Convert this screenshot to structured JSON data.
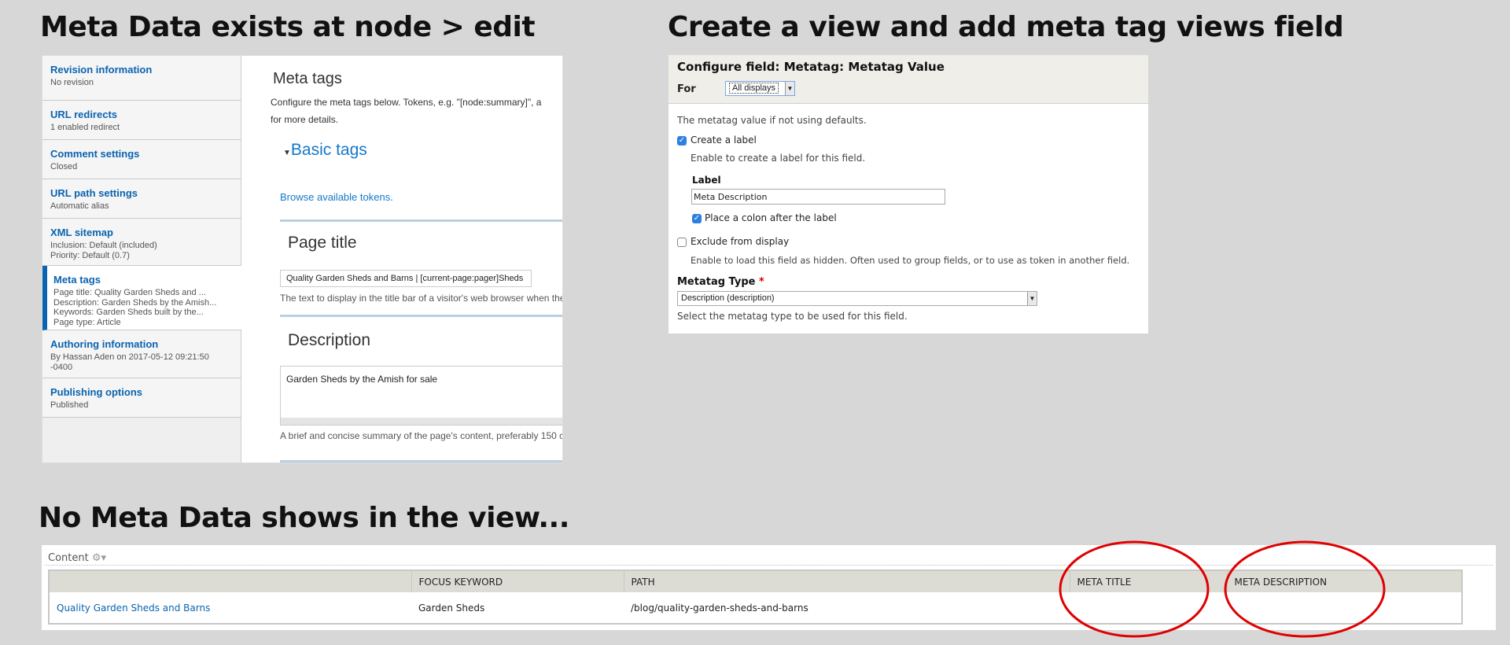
{
  "headings": {
    "left": "Meta Data exists at node > edit",
    "right": "Create a view and add meta tag views field",
    "bottom": "No Meta Data shows in the view..."
  },
  "node_edit": {
    "sidebar": [
      {
        "title": "Revision information",
        "desc": [
          "No revision"
        ]
      },
      {
        "title": "URL redirects",
        "desc": [
          "1 enabled redirect"
        ]
      },
      {
        "title": "Comment settings",
        "desc": [
          "Closed"
        ]
      },
      {
        "title": "URL path settings",
        "desc": [
          "Automatic alias"
        ]
      },
      {
        "title": "XML sitemap",
        "desc": [
          "Inclusion: Default (included)",
          "Priority: Default (0.7)"
        ]
      },
      {
        "title": "Meta tags",
        "desc": [
          "Page title: Quality Garden Sheds and ...",
          "Description: Garden Sheds by the Amish...",
          "Keywords: Garden Sheds built by the...",
          "Page type: Article"
        ]
      },
      {
        "title": "Authoring information",
        "desc": [
          "By Hassan Aden on 2017-05-12 09:21:50",
          "-0400"
        ]
      },
      {
        "title": "Publishing options",
        "desc": [
          "Published"
        ]
      }
    ],
    "title": "Meta tags",
    "intro_line1": "Configure the meta tags below. Tokens, e.g. \"[node:summary]\", a",
    "intro_line2": "for more details.",
    "basic_tags": "Basic tags",
    "browse_tokens": "Browse available tokens.",
    "page_title_label": "Page title",
    "page_title_value": "Quality Garden Sheds and Barns | [current-page:pager]Sheds",
    "page_title_help": "The text to display in the title bar of a visitor's web browser when the",
    "description_label": "Description",
    "description_value": "Garden Sheds by the Amish for sale",
    "description_help": "A brief and concise summary of the page's content, preferably 150 c"
  },
  "configure": {
    "title": "Configure field: Metatag: Metatag Value",
    "for_label": "For",
    "for_value": "All displays",
    "desc": "The metatag value if not using defaults.",
    "create_label": "Create a label",
    "create_label_help": "Enable to create a label for this field.",
    "label_heading": "Label",
    "label_value": "Meta Description",
    "colon": "Place a colon after the label",
    "exclude": "Exclude from display",
    "exclude_help": "Enable to load this field as hidden. Often used to group fields, or to use as token in another field.",
    "type_label": "Metatag Type",
    "required": "*",
    "type_value": "Description (description)",
    "type_help": "Select the metatag type to be used for this field."
  },
  "view": {
    "title": "Content",
    "columns": [
      "",
      "FOCUS KEYWORD",
      "PATH",
      "META TITLE",
      "META DESCRIPTION"
    ],
    "rows": [
      [
        "Quality Garden Sheds and Barns",
        "Garden Sheds",
        "/blog/quality-garden-sheds-and-barns",
        "",
        ""
      ]
    ]
  },
  "colors": {
    "link": "#0a63b0",
    "annotation": "#e00000"
  }
}
